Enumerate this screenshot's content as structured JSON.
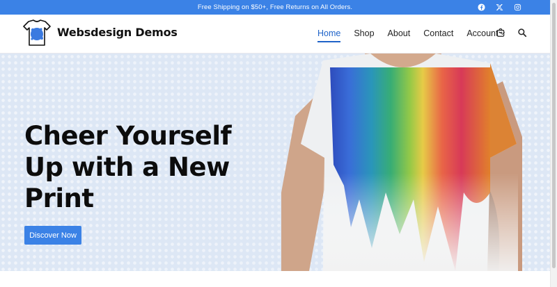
{
  "topbar": {
    "text": "Free Shipping on $50+, Free Returns on All Orders.",
    "social": [
      "facebook-icon",
      "x-icon",
      "instagram-icon"
    ]
  },
  "header": {
    "site_title": "Websdesign Demos",
    "nav": [
      {
        "label": "Home",
        "active": true
      },
      {
        "label": "Shop",
        "active": false
      },
      {
        "label": "About",
        "active": false
      },
      {
        "label": "Contact",
        "active": false
      },
      {
        "label": "Account",
        "active": false
      }
    ],
    "icons": [
      "cart-icon",
      "search-icon"
    ]
  },
  "hero": {
    "heading": "Cheer Yourself Up with a New Print",
    "button_label": "Discover Now"
  },
  "colors": {
    "accent": "#3b82e6",
    "nav_active": "#1f63c8",
    "hero_bg": "#dde7f5"
  }
}
